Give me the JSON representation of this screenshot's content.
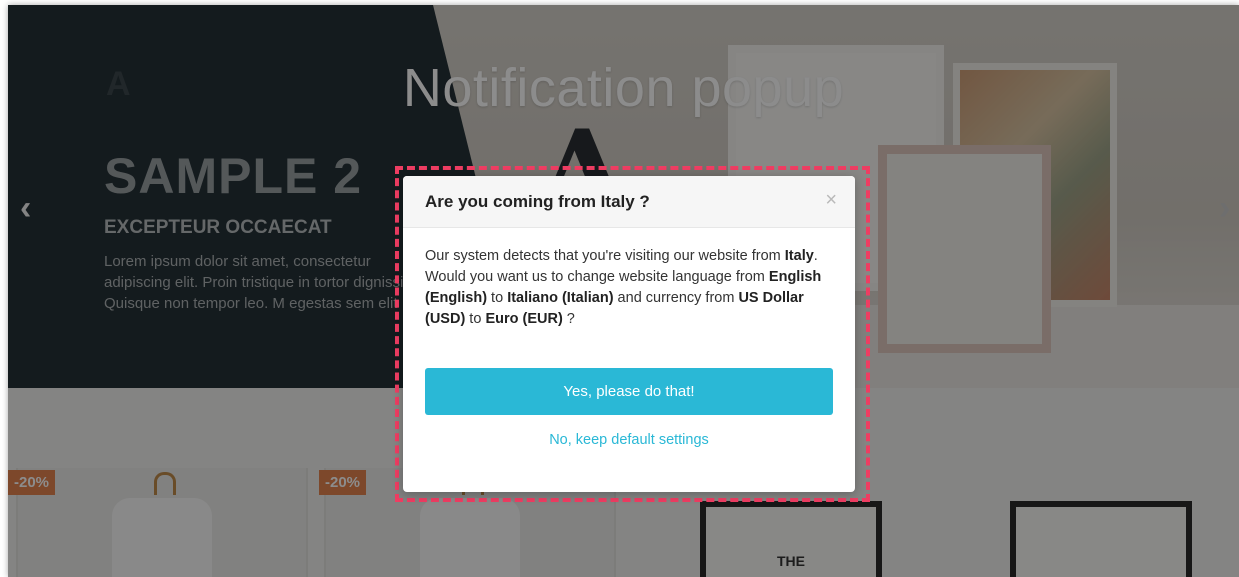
{
  "page": {
    "title": "Notification popup"
  },
  "background": {
    "logo": "A",
    "slide_title": "SAMPLE 2",
    "slide_subtitle": "EXCEPTEUR OCCAECAT",
    "slide_text": "Lorem ipsum dolor sit amet, consectetur adipiscing elit. Proin tristique in tortor dignissim. Quisque non tempor leo. M egestas sem elit",
    "decorative_letter": "A",
    "prev_arrow": "‹",
    "next_arrow": "›",
    "products": [
      {
        "discount": "-20%"
      },
      {
        "discount": "-20%"
      }
    ],
    "poster_text": "THE"
  },
  "popup": {
    "title": "Are you coming from Italy ?",
    "close_icon": "×",
    "body": {
      "intro": "Our system detects that you're visiting our website from ",
      "country": "Italy",
      "mid1": ". Would you want us to change website language from ",
      "lang_from": "English (English)",
      "to1": " to ",
      "lang_to": "Italiano (Italian)",
      "mid2": " and currency from ",
      "currency_from": "US Dollar (USD)",
      "to2": " to ",
      "currency_to": "Euro (EUR)",
      "end": " ?"
    },
    "confirm_label": "Yes, please do that!",
    "decline_label": "No, keep default settings"
  },
  "colors": {
    "accent": "#2ab8d6",
    "highlight_border": "#ee3d62",
    "hero_dark": "#263238",
    "discount_badge": "#e3844f"
  }
}
